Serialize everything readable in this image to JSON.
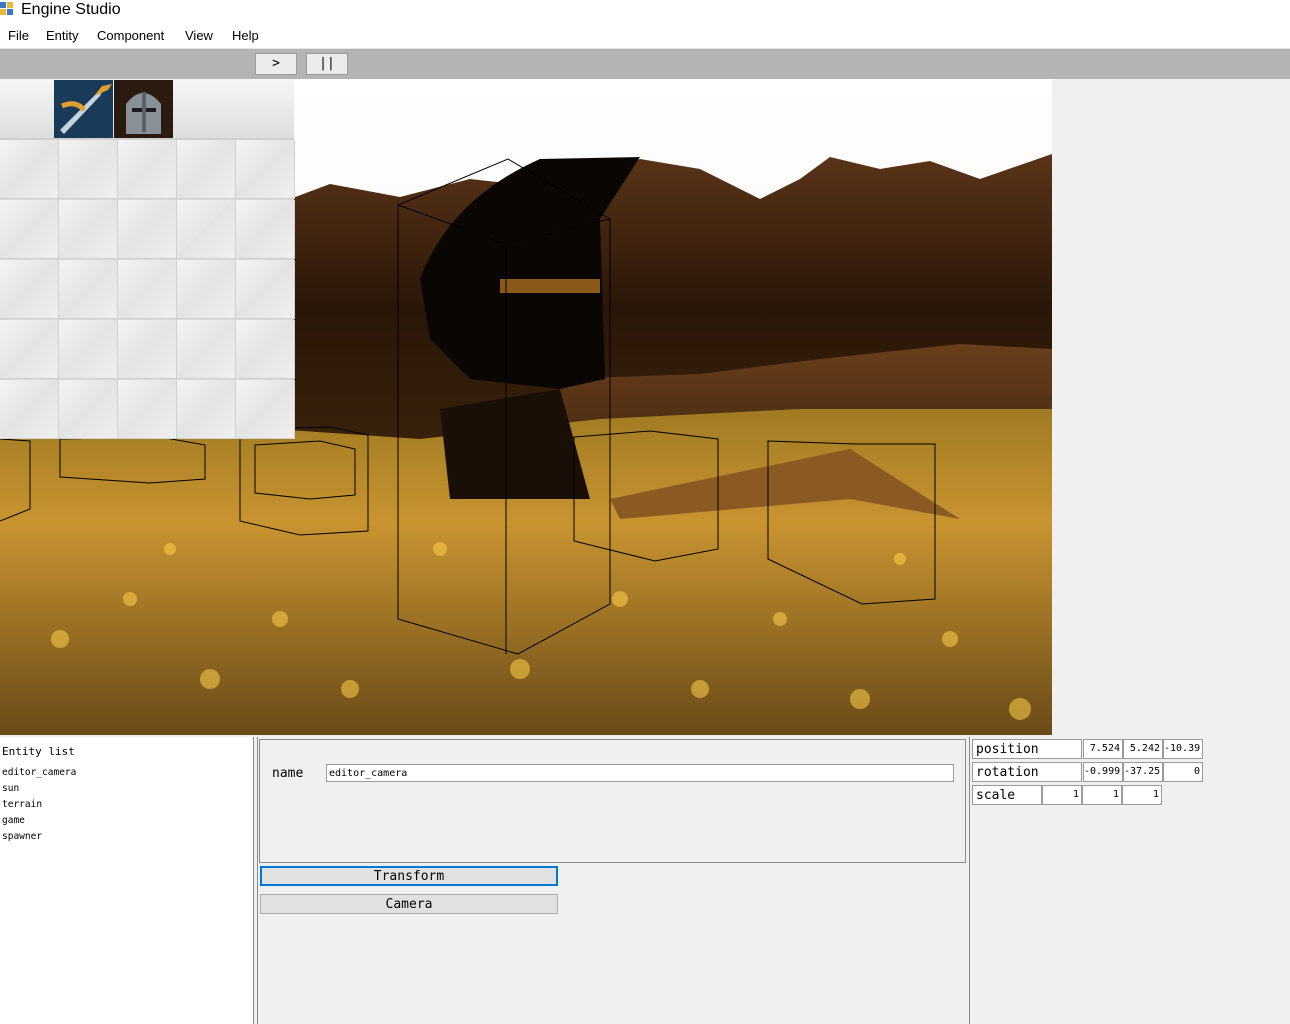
{
  "window": {
    "title": "Engine Studio",
    "icon": "app-window-icon"
  },
  "menu": {
    "items": [
      "File",
      "Entity",
      "Component",
      "View",
      "Help"
    ]
  },
  "toolbar": {
    "play_label": ">",
    "pause_label": "||"
  },
  "viewport": {
    "scene": "3d-game-scene"
  },
  "inventory": {
    "columns": 5,
    "rows": 6,
    "items": [
      "sword-item-icon",
      "knight-helmet-item-icon"
    ]
  },
  "entity_list": {
    "title": "Entity list",
    "items": [
      "editor_camera",
      "sun",
      "terrain",
      "game",
      "spawner"
    ]
  },
  "inspector": {
    "name_label": "name",
    "name_value": "editor_camera",
    "components": [
      "Transform",
      "Camera"
    ],
    "active_component": "Transform"
  },
  "transform": {
    "position": {
      "label": "position",
      "values": [
        "7.524",
        "5.242",
        "-10.39"
      ]
    },
    "rotation": {
      "label": "rotation",
      "values": [
        "-0.999",
        "-37.25",
        "0"
      ]
    },
    "scale": {
      "label": "scale",
      "values": [
        "1",
        "1",
        "1"
      ]
    }
  },
  "colors": {
    "toolbar_bg": "#b4b4b4",
    "focus_border": "#0078d7",
    "panel_bg": "#f0f0f0"
  }
}
